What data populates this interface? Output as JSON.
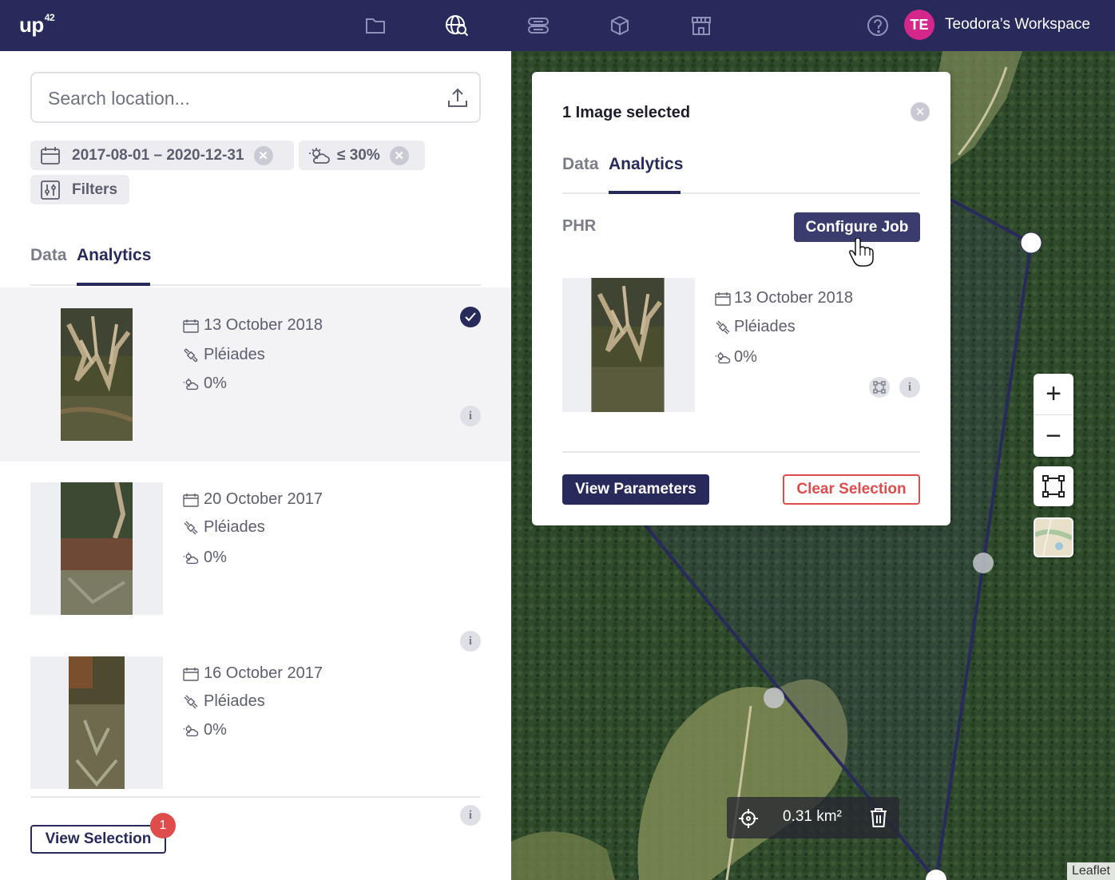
{
  "brand": {
    "logo_text": "up",
    "logo_sup": "42"
  },
  "topnav": {
    "icons": [
      "folder-icon",
      "globe-search-icon",
      "server-icon",
      "cube-icon",
      "storefront-icon"
    ],
    "help_icon": "help-icon",
    "avatar_initials": "TE",
    "avatar_color": "#d5278b",
    "workspace": "Teodora’s Workspace",
    "bg_color": "#282a5c"
  },
  "search": {
    "placeholder": "Search location..."
  },
  "filters": {
    "date_range": "2017-08-01 – 2020-12-31",
    "cloud_cover": "≤ 30%",
    "filters_label": "Filters"
  },
  "tabs": {
    "data": "Data",
    "analytics": "Analytics",
    "active": "Analytics"
  },
  "results": [
    {
      "date": "13 October 2018",
      "sensor": "Pléiades",
      "cloud": "0%",
      "selected": true
    },
    {
      "date": "20 October 2017",
      "sensor": "Pléiades",
      "cloud": "0%",
      "selected": false
    },
    {
      "date": "16 October 2017",
      "sensor": "Pléiades",
      "cloud": "0%",
      "selected": false
    }
  ],
  "view_selection": {
    "label": "View Selection",
    "count": "1"
  },
  "popup": {
    "title": "1 Image selected",
    "tabs": {
      "data": "Data",
      "analytics": "Analytics"
    },
    "phr": "PHR",
    "configure_job": "Configure Job",
    "image": {
      "date": "13 October 2018",
      "sensor": "Pléiades",
      "cloud": "0%"
    },
    "view_parameters": "View Parameters",
    "clear_selection": "Clear Selection"
  },
  "map": {
    "area": "0.31 km²",
    "attribution": "Leaflet",
    "zoom_in": "+",
    "zoom_out": "−"
  },
  "colors": {
    "primary": "#282a5c",
    "danger": "#e04b4b"
  }
}
